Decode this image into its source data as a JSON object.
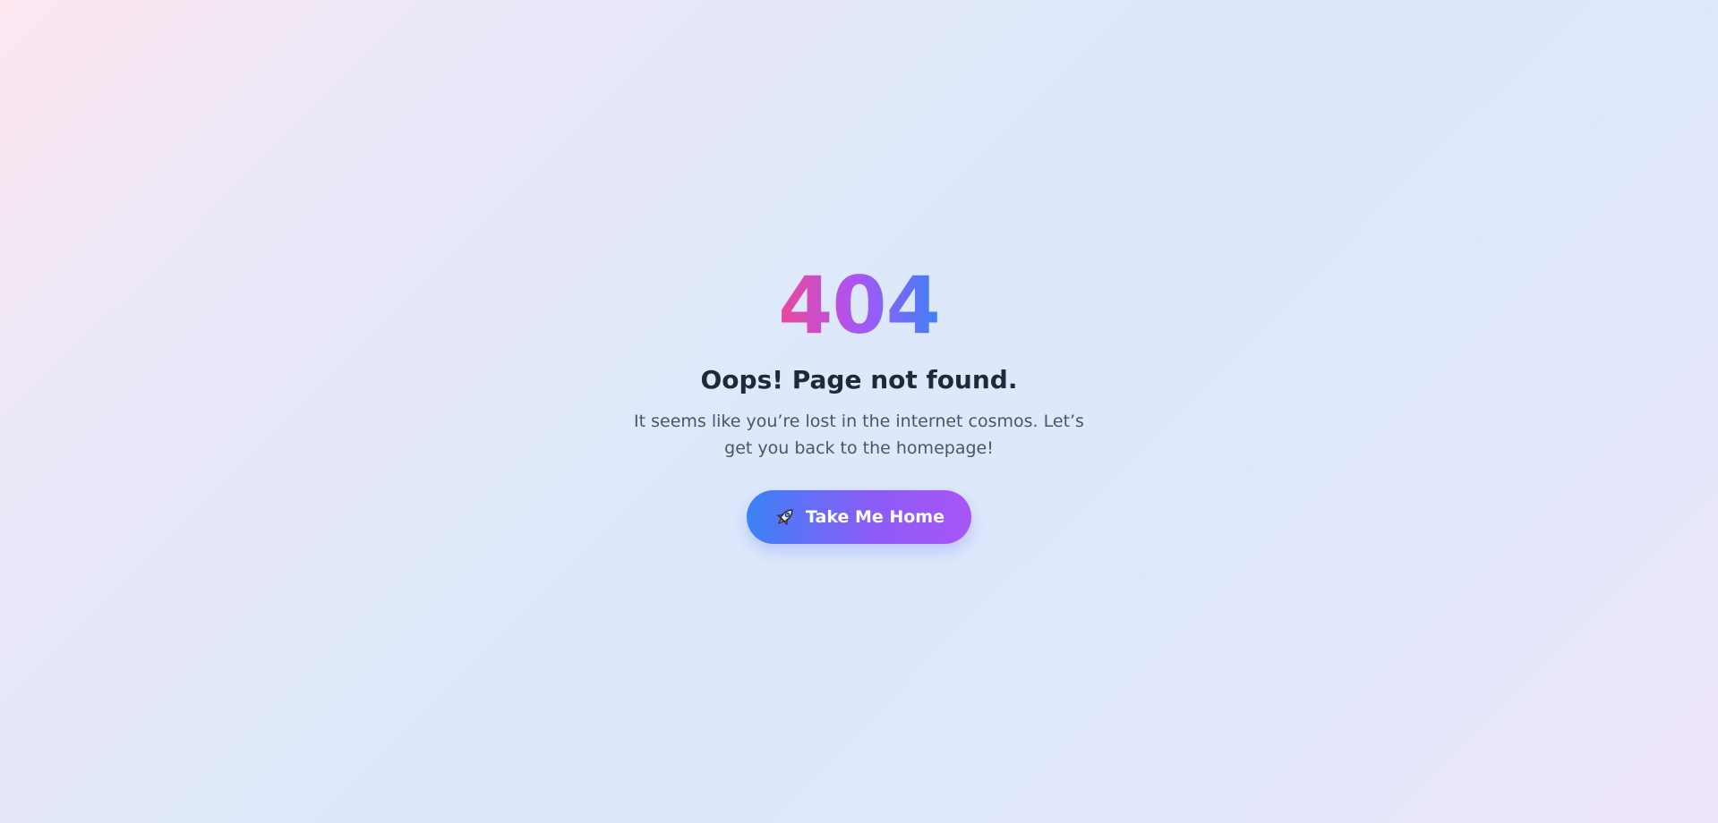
{
  "error": {
    "code": "404",
    "headline": "Oops! Page not found.",
    "message": "It seems like you’re lost in the internet cosmos. Let’s get you back to the homepage!"
  },
  "actions": {
    "home_button": {
      "icon": "rocket-icon",
      "label": "Take Me Home"
    }
  },
  "colors": {
    "gradient_pink": "#ec4899",
    "gradient_purple": "#a855f7",
    "gradient_blue": "#3b82f6",
    "headline_text": "#1f2937",
    "body_text": "#4b5563"
  }
}
